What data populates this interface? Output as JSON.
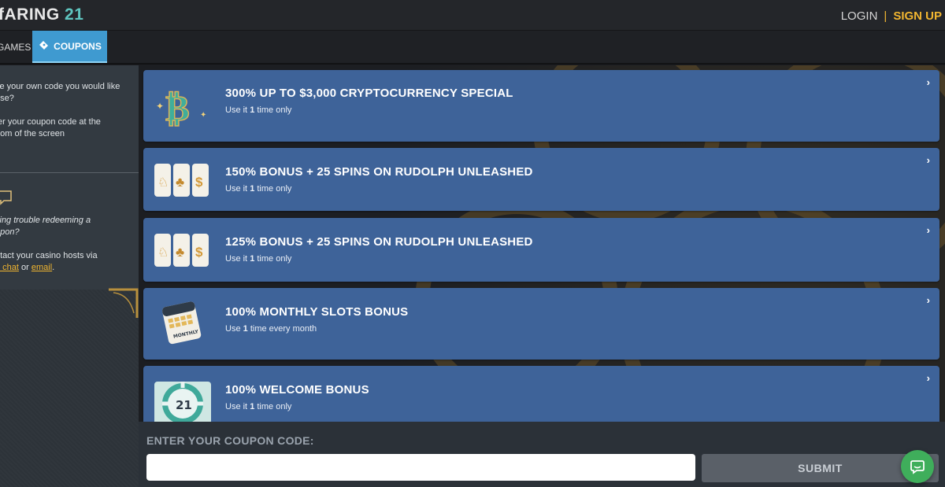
{
  "header": {
    "logo_text": "ARING",
    "logo_number": "21",
    "login_label": "LOGIN",
    "separator": "|",
    "signup_label": "SIGN UP"
  },
  "tabs": [
    {
      "label": "GAMES",
      "active": false
    },
    {
      "label": "COUPONS",
      "active": true,
      "icon": "ticket-icon"
    }
  ],
  "sidebar": {
    "help_lines": [
      "ve your own code you would like",
      "use?"
    ],
    "instruction_lines": [
      "ter your coupon code at the",
      "ttom of the screen"
    ],
    "trouble_lines": [
      "ving trouble redeeming a",
      "upon?"
    ],
    "contact_line": "ntact your casino hosts via",
    "link_chat": "e chat",
    "link_or": "or",
    "link_email": "email",
    "link_end": ".",
    "chat_icon": "chat-bubble-icon"
  },
  "coupons": [
    {
      "title": "300% UP TO $3,000 CRYPTOCURRENCY SPECIAL",
      "use_prefix": "Use it",
      "use_count": "1",
      "use_suffix": "time only",
      "icon": "bitcoin-icon"
    },
    {
      "title": "150% BONUS + 25 SPINS ON RUDOLPH UNLEASHED",
      "use_prefix": "Use it",
      "use_count": "1",
      "use_suffix": "time only",
      "icon": "slot-reels-icon"
    },
    {
      "title": "125% BONUS + 25 SPINS ON RUDOLPH UNLEASHED",
      "use_prefix": "Use it",
      "use_count": "1",
      "use_suffix": "time only",
      "icon": "slot-reels-icon"
    },
    {
      "title": "100% MONTHLY SLOTS BONUS",
      "use_prefix": "Use",
      "use_count": "1",
      "use_suffix": "time every month",
      "icon": "calendar-icon",
      "icon_text": "MONTHLY"
    },
    {
      "title": "100% WELCOME BONUS",
      "use_prefix": "Use it",
      "use_count": "1",
      "use_suffix": "time only",
      "icon": "casino-chip-icon",
      "icon_text": "21"
    }
  ],
  "entry": {
    "label": "ENTER YOUR COUPON CODE:",
    "input_value": "",
    "submit_label": "SUBMIT"
  },
  "colors": {
    "card": "#3e6399",
    "accent_gold": "#f2b630",
    "tab_active": "#3f9ad0",
    "chat_fab": "#3fae5b"
  },
  "chevron": "›"
}
